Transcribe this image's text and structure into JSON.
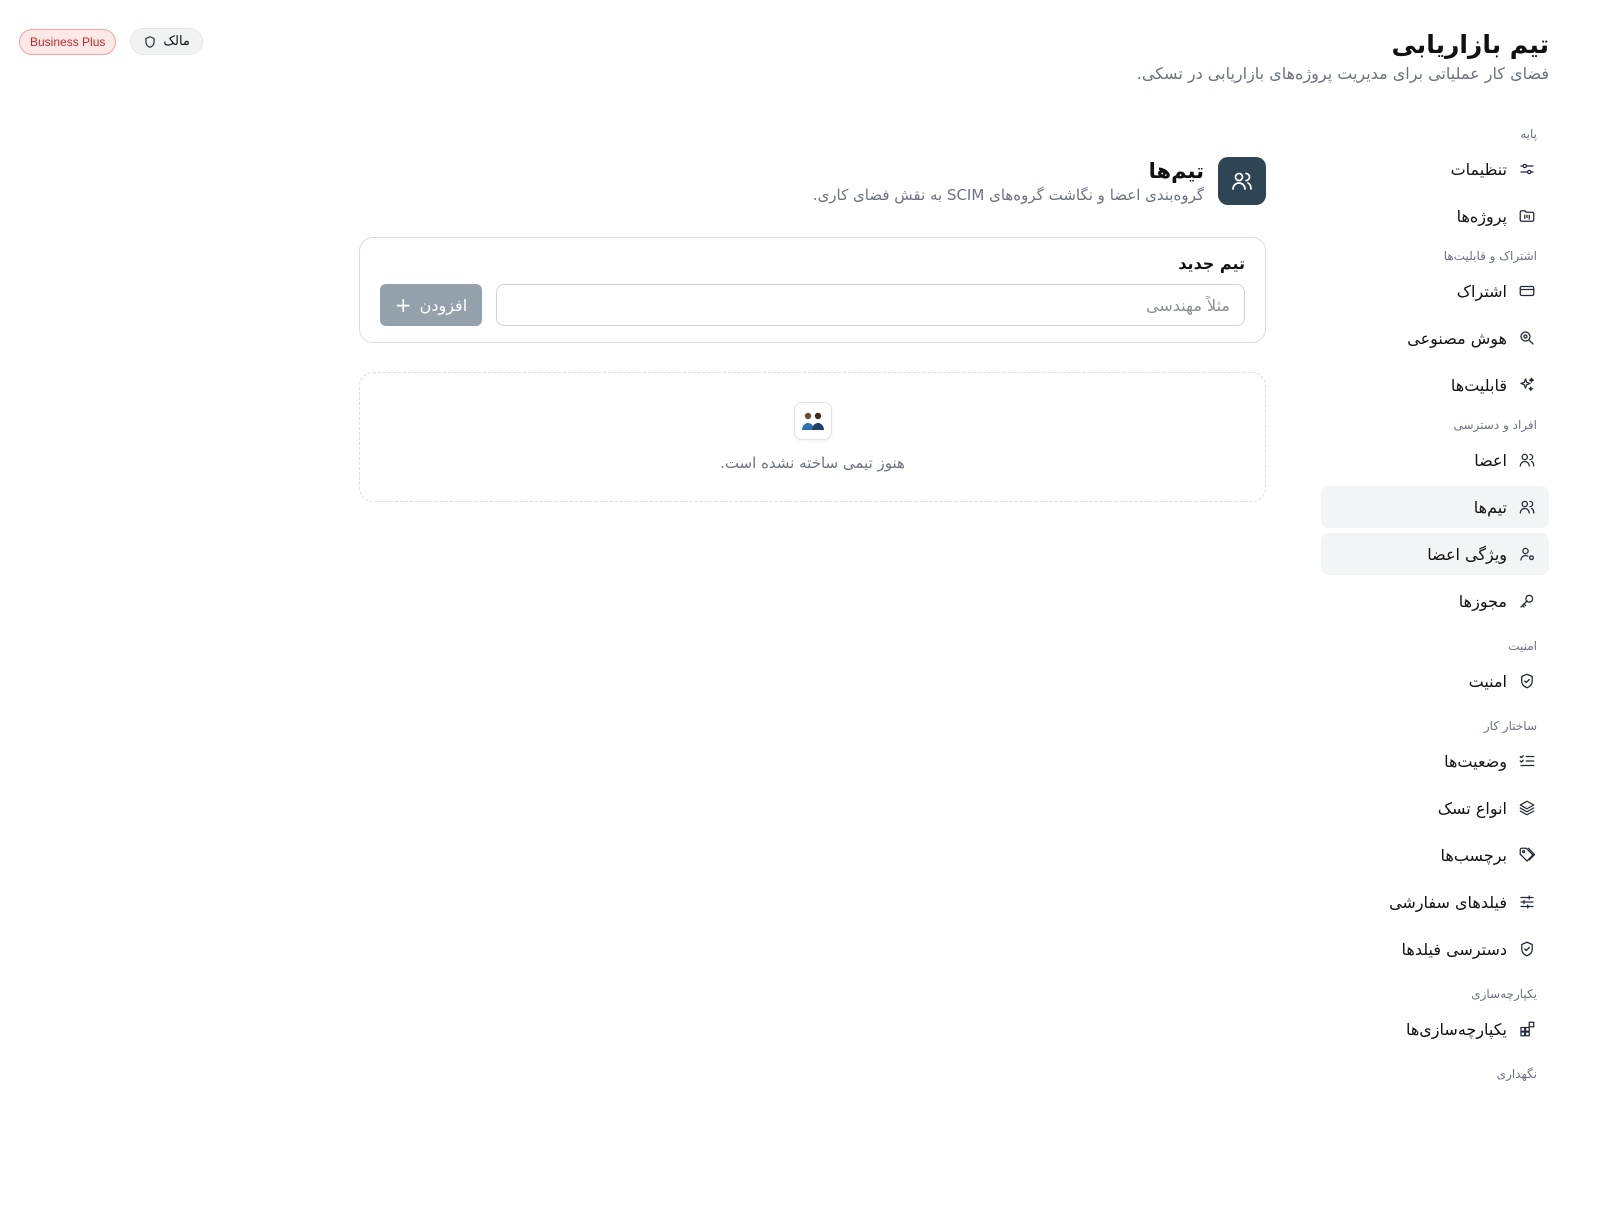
{
  "workspace": {
    "title": "تیم بازاریابی",
    "subtitle": "فضای کار عملیاتی برای مدیریت پروژه‌های بازاریابی در تسکی."
  },
  "badges": {
    "role": "مالک",
    "plan": "Business Plus"
  },
  "sidebar": {
    "sections": [
      {
        "label": "پایه",
        "items": [
          {
            "label": "تنظیمات",
            "icon": "settings-sliders-icon"
          },
          {
            "label": "پروژه‌ها",
            "icon": "projects-folder-icon"
          }
        ]
      },
      {
        "label": "اشتراک و قابلیت‌ها",
        "items": [
          {
            "label": "اشتراک",
            "icon": "credit-card-icon"
          },
          {
            "label": "هوش مصنوعی",
            "icon": "ai-icon"
          },
          {
            "label": "قابلیت‌ها",
            "icon": "sparkles-icon"
          }
        ]
      },
      {
        "label": "افراد و دسترسی",
        "items": [
          {
            "label": "اعضا",
            "icon": "users-icon"
          },
          {
            "label": "تیم‌ها",
            "icon": "team-icon",
            "active": true
          },
          {
            "label": "ویژگی اعضا",
            "icon": "user-attribute-icon"
          },
          {
            "label": "مجوزها",
            "icon": "key-icon"
          }
        ]
      },
      {
        "label": "امنیت",
        "items": [
          {
            "label": "امنیت",
            "icon": "shield-check-icon"
          }
        ]
      },
      {
        "label": "ساختار کار",
        "items": [
          {
            "label": "وضعیت‌ها",
            "icon": "status-list-icon"
          },
          {
            "label": "انواع تسک",
            "icon": "layers-icon"
          },
          {
            "label": "برچسب‌ها",
            "icon": "tags-icon"
          },
          {
            "label": "فیلدهای سفارشی",
            "icon": "sliders-icon"
          },
          {
            "label": "دسترسی فیلدها",
            "icon": "shield-check-icon"
          }
        ]
      },
      {
        "label": "یکپارچه‌سازی",
        "items": [
          {
            "label": "یکپارچه‌سازی‌ها",
            "icon": "integrations-icon"
          }
        ]
      },
      {
        "label": "نگهداری",
        "items": []
      }
    ]
  },
  "main": {
    "title": "تیم‌ها",
    "description": "گروه‌بندی اعضا و نگاشت گروه‌های SCIM به نقش فضای کاری.",
    "new_team": {
      "label": "تیم جدید",
      "placeholder": "مثلاً مهندسی",
      "value": "",
      "add_label": "افزودن"
    },
    "empty_state": {
      "text": "هنوز تیمی ساخته نشده است."
    }
  },
  "colors": {
    "accent": "#2d4555",
    "button_disabled": "#94a0ab",
    "plan_badge_text": "#c62828",
    "plan_badge_bg": "#fde8e8"
  }
}
